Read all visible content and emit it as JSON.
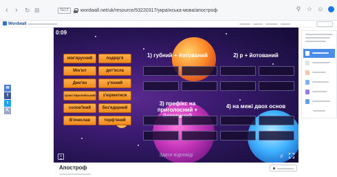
{
  "browser": {
    "url": "wordwall.net/uk/resource/53220317/українська-мова/апостроф",
    "security_tag": "ТЕСТ",
    "nav_icons": [
      "back-icon",
      "forward-icon",
      "reload-icon",
      "apps-icon"
    ],
    "action_icons": [
      "search-icon",
      "bookmark-icon",
      "profile-icon",
      "extension-icon"
    ]
  },
  "site": {
    "logo": "Wordwall"
  },
  "share_icons": [
    "email-icon",
    "facebook-icon",
    "twitter-icon",
    "share-icon"
  ],
  "game": {
    "timer": "0:09",
    "tiles": [
      "між'ярусний",
      "подвір'я",
      "Мін'ют",
      "дит'ясла",
      "Дем'ян",
      "у'язний",
      "транс'європейський",
      "з'юрмитися",
      "солов'їний",
      "без'ядерний",
      "В'ячеслав",
      "торф'яний"
    ],
    "categories": [
      "1) губний + йотований",
      "2) р + йотований",
      "3) префікс на приголосний + йотований",
      "4) на межі двох основ"
    ],
    "submit_label": "Здати відповіді",
    "menu_icon": "menu-icon",
    "volume_icon": "volume-icon",
    "fullscreen_icon": "fullscreen-icon"
  },
  "activity": {
    "title": "Апостроф"
  },
  "colors": {
    "tile": "#f59a2a",
    "tile_text": "#3b1a05",
    "slot": "#160c30",
    "sidebar_selected": "#4a8de8"
  }
}
